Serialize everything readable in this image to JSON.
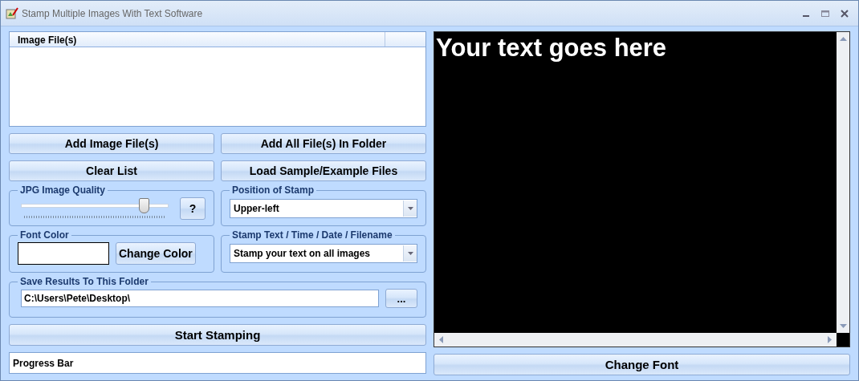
{
  "window": {
    "title": "Stamp Multiple Images With Text Software"
  },
  "file_list": {
    "columns": [
      "Image File(s)"
    ]
  },
  "buttons_row_1": [
    "Add Image File(s)",
    "Add All File(s) In Folder"
  ],
  "buttons_row_2": [
    "Clear List",
    "Load Sample/Example Files"
  ],
  "jpg_quality": {
    "label": "JPG Image Quality",
    "level": 0.83,
    "help": "?"
  },
  "position": {
    "label": "Position of Stamp",
    "value": "Upper-left"
  },
  "font_color": {
    "label": "Font Color",
    "button": "Change Color"
  },
  "stamp_text": {
    "label": "Stamp Text / Time / Date / Filename",
    "value": "Stamp your text on all images"
  },
  "save_folder": {
    "label": "Save Results To This Folder",
    "value": "C:\\Users\\Pete\\Desktop\\",
    "browse": "..."
  },
  "start_button": "Start Stamping",
  "progress": {
    "value": "Progress Bar"
  },
  "preview": {
    "text": "Your text goes here"
  },
  "change_font_button": "Change Font"
}
